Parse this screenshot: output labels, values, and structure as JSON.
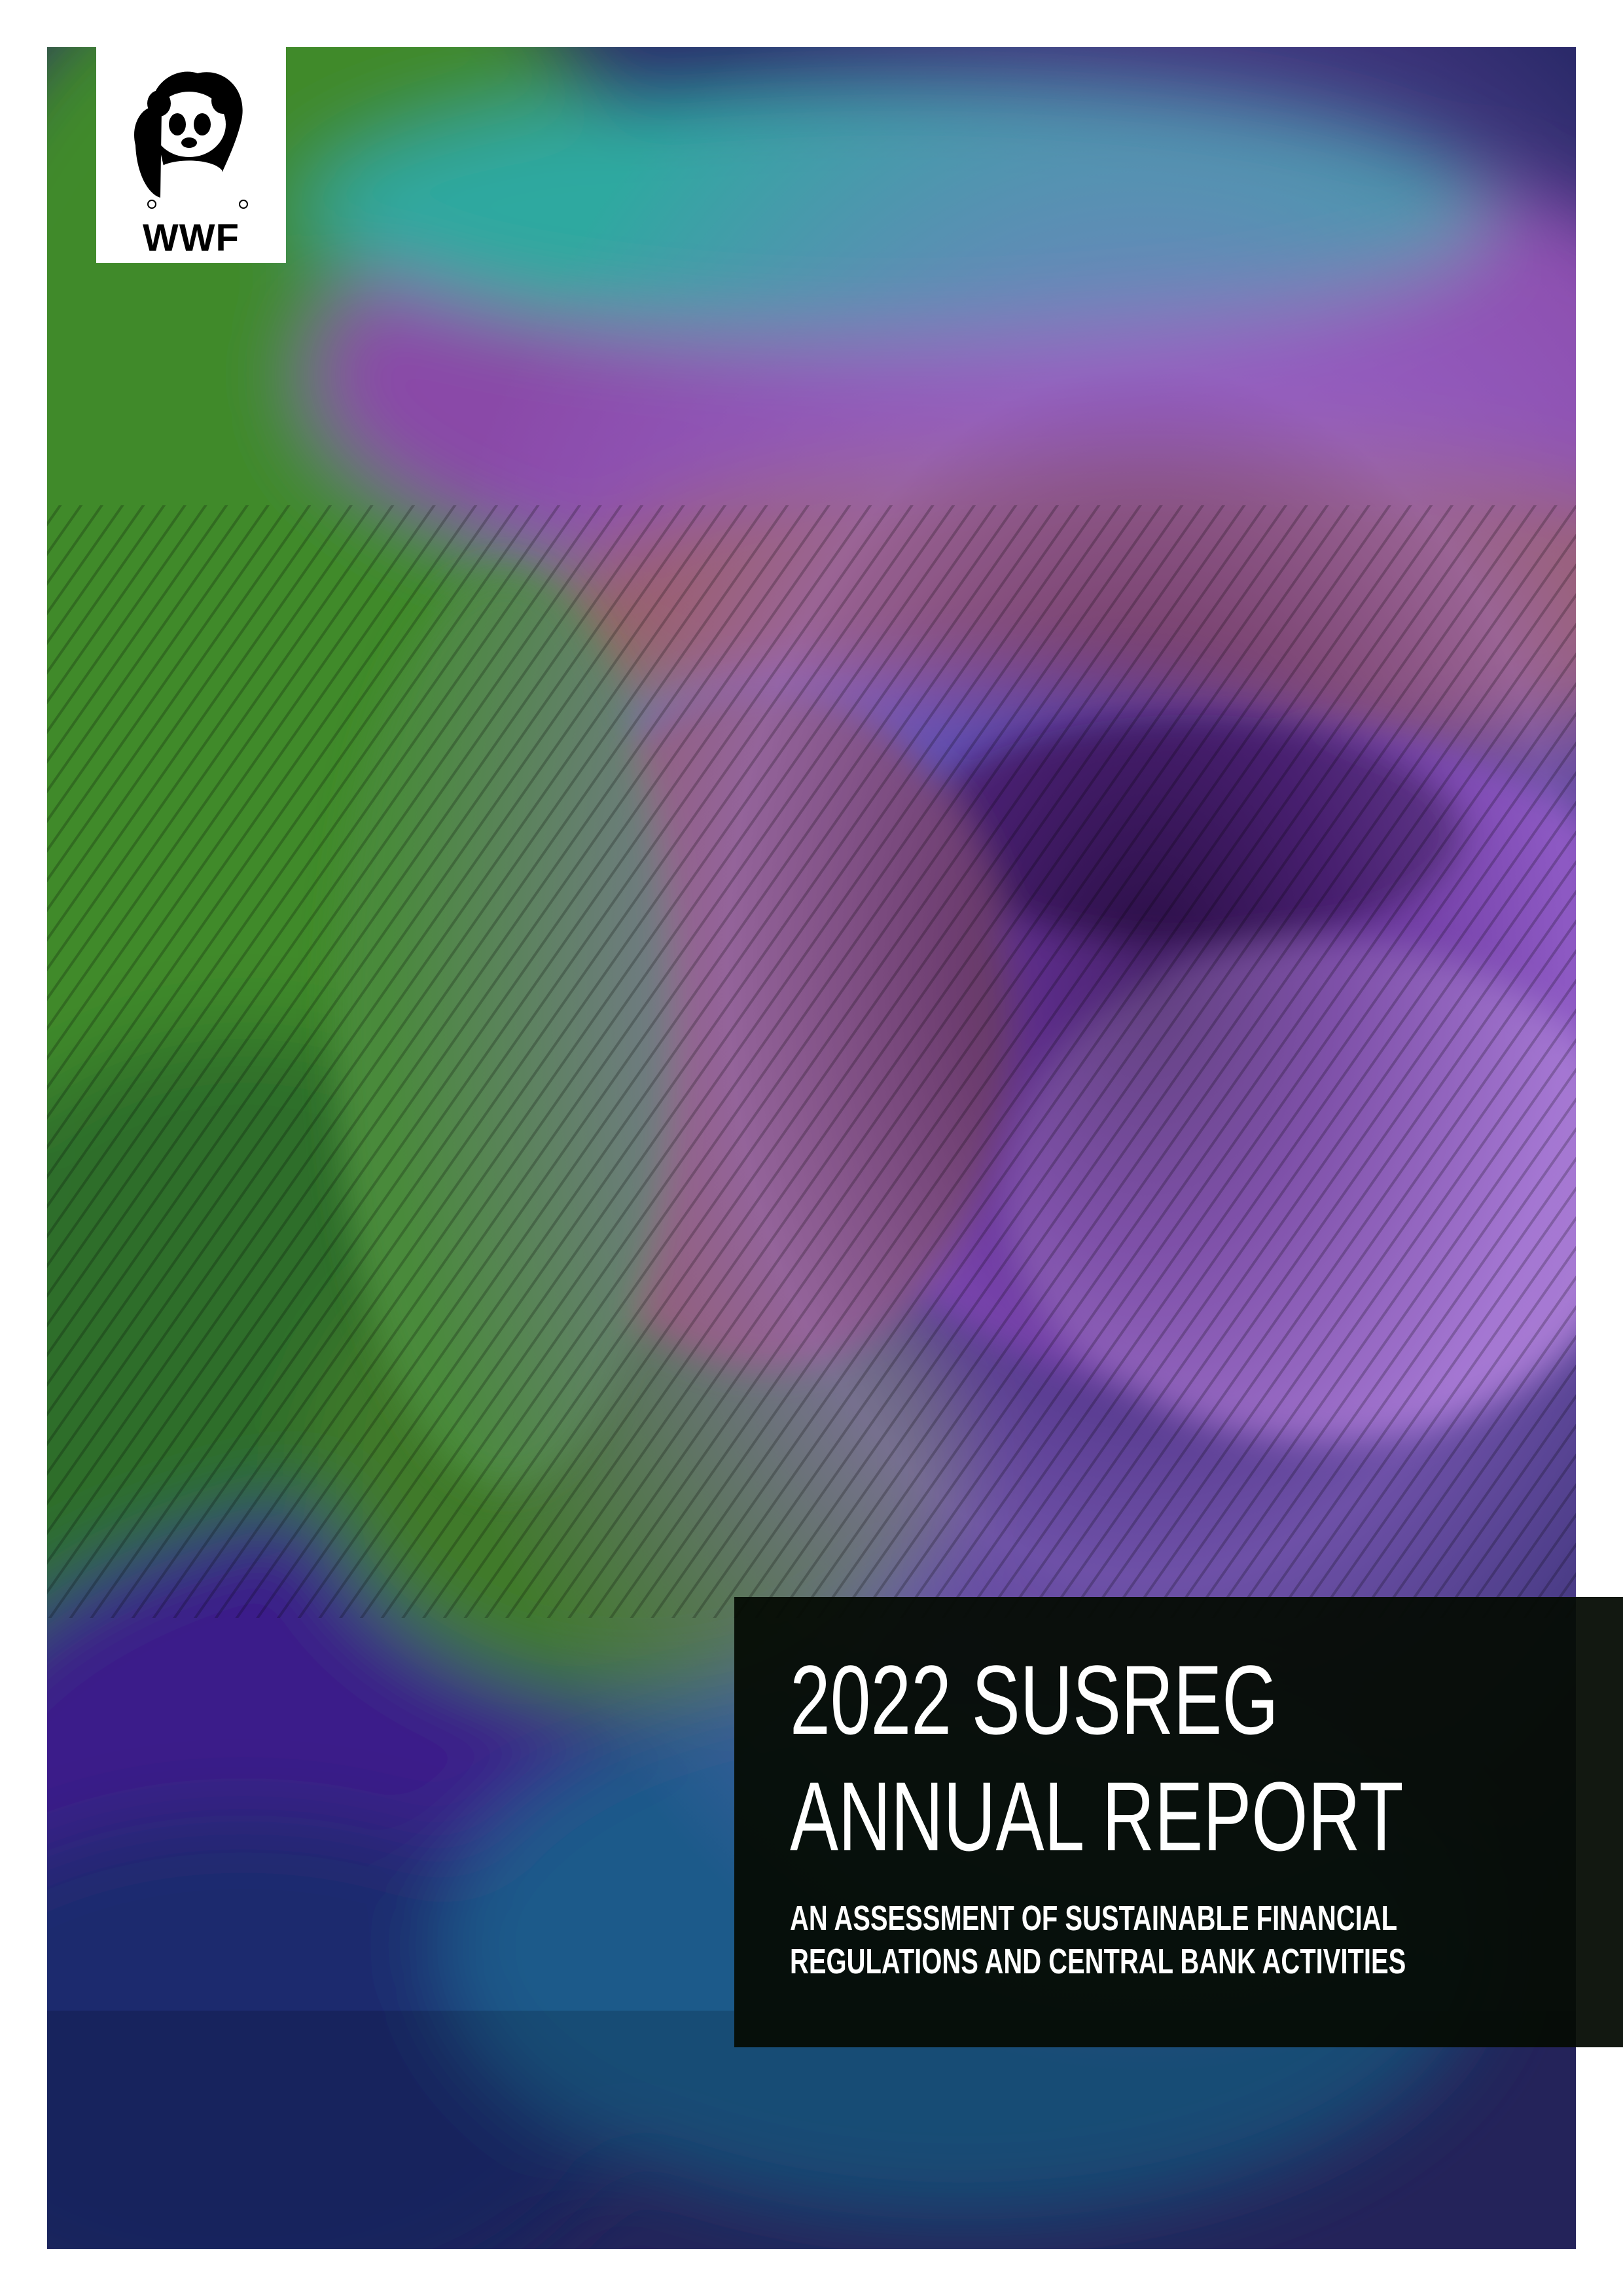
{
  "cover": {
    "logo": {
      "name": "WWF panda logo",
      "text": "WWF"
    },
    "title_lines": [
      "2022 SUSREG",
      "ANNUAL REPORT"
    ],
    "subtitle_lines": [
      "AN ASSESSMENT OF SUSTAINABLE FINANCIAL",
      "REGULATIONS AND CENTRAL BANK ACTIVITIES"
    ],
    "photo": {
      "subject": "peacock-feather-macro",
      "colors": {
        "deep_purple": "#3a1f6b",
        "violet": "#7a3fb0",
        "lilac": "#b48ad6",
        "teal": "#2fa9a0",
        "green": "#3f8a2a",
        "copper": "#9a5a3a",
        "navy": "#1c2a6e"
      }
    },
    "panel_color": "#050c04"
  }
}
